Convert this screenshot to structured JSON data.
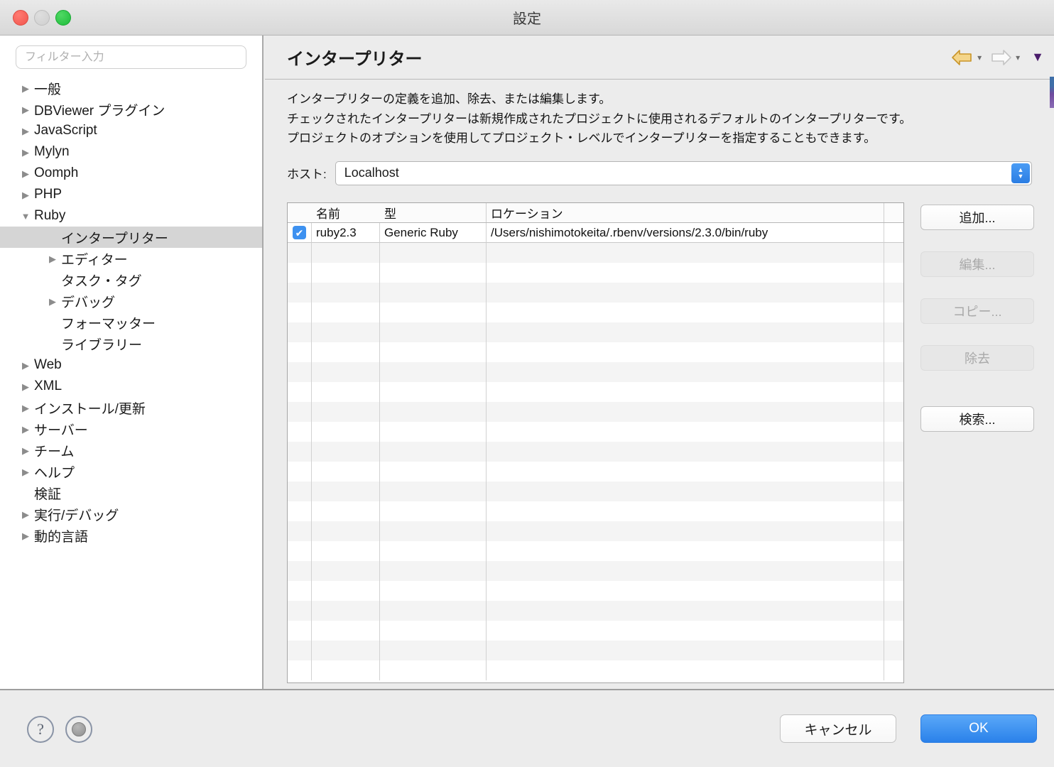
{
  "window": {
    "title": "設定",
    "traffic_lights": [
      "close",
      "minimize",
      "maximize"
    ]
  },
  "sidebar": {
    "filter": {
      "placeholder": "フィルター入力",
      "value": ""
    },
    "items": [
      {
        "label": "一般",
        "indent": 0,
        "twisty": "collapsed",
        "selected": false
      },
      {
        "label": "DBViewer プラグイン",
        "indent": 0,
        "twisty": "collapsed",
        "selected": false
      },
      {
        "label": "JavaScript",
        "indent": 0,
        "twisty": "collapsed",
        "selected": false
      },
      {
        "label": "Mylyn",
        "indent": 0,
        "twisty": "collapsed",
        "selected": false
      },
      {
        "label": "Oomph",
        "indent": 0,
        "twisty": "collapsed",
        "selected": false
      },
      {
        "label": "PHP",
        "indent": 0,
        "twisty": "collapsed",
        "selected": false
      },
      {
        "label": "Ruby",
        "indent": 0,
        "twisty": "expanded",
        "selected": false
      },
      {
        "label": "インタープリター",
        "indent": 1,
        "twisty": "none",
        "selected": true
      },
      {
        "label": "エディター",
        "indent": 1,
        "twisty": "collapsed",
        "selected": false
      },
      {
        "label": "タスク・タグ",
        "indent": 1,
        "twisty": "none",
        "selected": false
      },
      {
        "label": "デバッグ",
        "indent": 1,
        "twisty": "collapsed",
        "selected": false
      },
      {
        "label": "フォーマッター",
        "indent": 1,
        "twisty": "none",
        "selected": false
      },
      {
        "label": "ライブラリー",
        "indent": 1,
        "twisty": "none",
        "selected": false
      },
      {
        "label": "Web",
        "indent": 0,
        "twisty": "collapsed",
        "selected": false
      },
      {
        "label": "XML",
        "indent": 0,
        "twisty": "collapsed",
        "selected": false
      },
      {
        "label": "インストール/更新",
        "indent": 0,
        "twisty": "collapsed",
        "selected": false
      },
      {
        "label": "サーバー",
        "indent": 0,
        "twisty": "collapsed",
        "selected": false
      },
      {
        "label": "チーム",
        "indent": 0,
        "twisty": "collapsed",
        "selected": false
      },
      {
        "label": "ヘルプ",
        "indent": 0,
        "twisty": "collapsed",
        "selected": false
      },
      {
        "label": "検証",
        "indent": 0,
        "twisty": "none",
        "selected": false
      },
      {
        "label": "実行/デバッグ",
        "indent": 0,
        "twisty": "collapsed",
        "selected": false
      },
      {
        "label": "動的言語",
        "indent": 0,
        "twisty": "collapsed",
        "selected": false
      }
    ]
  },
  "main": {
    "page_title": "インタープリター",
    "nav": {
      "back_icon": "back-arrow-icon",
      "forward_icon": "forward-arrow-icon",
      "menu_icon": "dropdown-triangle-icon"
    },
    "description": [
      "インタープリターの定義を追加、除去、または編集します。",
      "チェックされたインタープリターは新規作成されたプロジェクトに使用されるデフォルトのインタープリターです。",
      "プロジェクトのオプションを使用してプロジェクト・レベルでインタープリターを指定することもできます。"
    ],
    "host": {
      "label": "ホスト:",
      "value": "Localhost",
      "options": [
        "Localhost"
      ]
    },
    "table": {
      "columns": [
        "",
        "名前",
        "型",
        "ロケーション",
        ""
      ],
      "rows": [
        {
          "checked": true,
          "name": "ruby2.3",
          "type": "Generic Ruby",
          "location": "/Users/nishimotokeita/.rbenv/versions/2.3.0/bin/ruby"
        }
      ],
      "empty_row_count": 22
    },
    "side_buttons": [
      {
        "label": "追加...",
        "enabled": true
      },
      {
        "label": "編集...",
        "enabled": false
      },
      {
        "label": "コピー...",
        "enabled": false
      },
      {
        "label": "除去",
        "enabled": false
      },
      {
        "label": "検索...",
        "enabled": true
      }
    ]
  },
  "footer": {
    "help_icon": "question-mark-icon",
    "info_icon": "grey-circle-icon",
    "cancel_label": "キャンセル",
    "ok_label": "OK"
  },
  "colors": {
    "accent": "#2a81ea",
    "checkbox": "#3d91f0",
    "selection": "#d5d5d5",
    "back_arrow": "#e8b73c",
    "window_bg": "#ececec"
  }
}
